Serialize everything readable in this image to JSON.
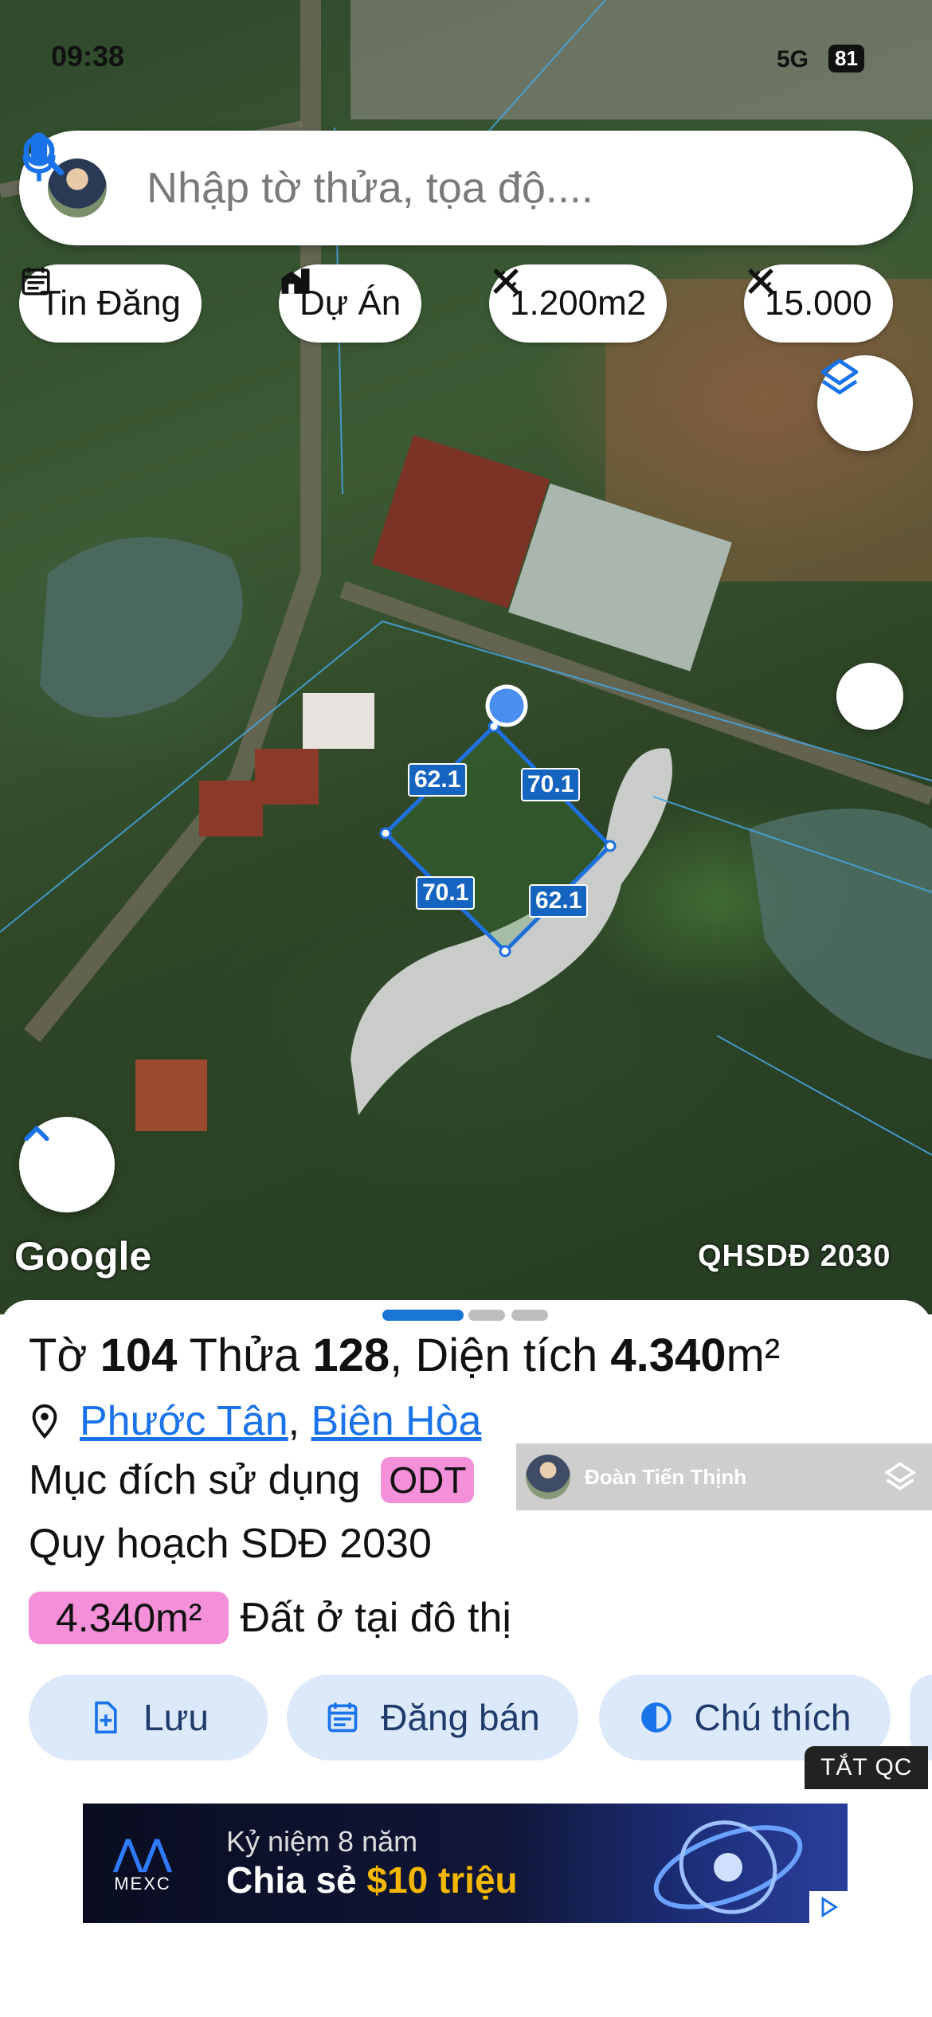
{
  "status_bar": {
    "time": "09:38",
    "network": "5G",
    "battery": "81"
  },
  "search": {
    "placeholder": "Nhập tờ thửa, tọa độ...."
  },
  "chips": [
    {
      "label": "Tin Đăng",
      "icon": "calendar-icon"
    },
    {
      "label": "Dự Án",
      "icon": "buildings-icon"
    },
    {
      "label": "1.200m2",
      "icon": "ruler-icon"
    },
    {
      "label": "15.000",
      "icon": "ruler-icon"
    }
  ],
  "map": {
    "logo": "Google",
    "layer_label": "QHSDĐ 2030",
    "dimensions": [
      "62.1",
      "70.1",
      "70.1",
      "62.1"
    ]
  },
  "parcel": {
    "sheet_label": "Tờ",
    "sheet_no": "104",
    "plot_label": "Thửa",
    "plot_no": "128",
    "area_label": "Diện tích",
    "area_value": "4.340",
    "area_unit": "m²",
    "ward": "Phước Tân",
    "city": "Biên Hòa",
    "usage_label": "Mục đích sử dụng",
    "usage_code": "ODT",
    "plan_label": "Quy hoạch SDĐ 2030",
    "plan_area": "4.340m²",
    "plan_type": "Đất ở tại đô thị"
  },
  "owner": {
    "name": "Đoàn Tiến Thịnh"
  },
  "actions": {
    "save": "Lưu",
    "post_sale": "Đăng bán",
    "legend": "Chú thích"
  },
  "ads": {
    "off_label": "TẮT QC",
    "brand": "MEXC",
    "line1": "Kỷ niệm 8 năm",
    "line2_prefix": "Chia sẻ ",
    "line2_highlight": "$10 triệu"
  },
  "colors": {
    "accent": "#1a73e8",
    "badge_pink": "#f48fda",
    "action_bg": "#dce9fa",
    "parcel_outline": "#1e6fe0"
  }
}
